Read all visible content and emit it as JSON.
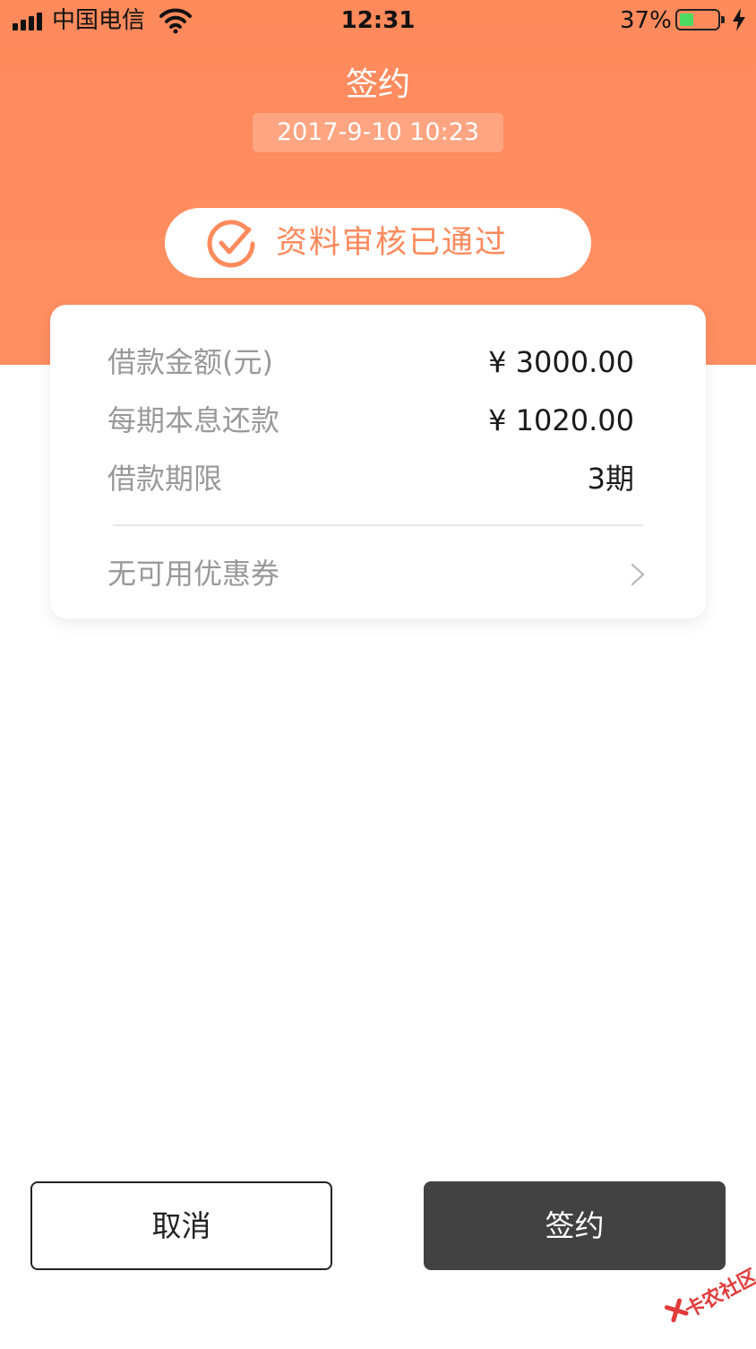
{
  "status_bar": {
    "carrier": "中国电信",
    "time": "12:31",
    "battery_percent": "37%",
    "battery_level": 0.37,
    "charging": true
  },
  "header": {
    "title": "签约",
    "datetime": "2017-9-10 10:23",
    "approval_text": "资料审核已通过",
    "accent_color": "#ff8a5c"
  },
  "loan_card": {
    "rows": [
      {
        "label": "借款金额(元)",
        "value": "¥ 3000.00"
      },
      {
        "label": "每期本息还款",
        "value": "¥ 1020.00"
      },
      {
        "label": "借款期限",
        "value": "3期"
      }
    ],
    "coupon_label": "无可用优惠券"
  },
  "actions": {
    "cancel_label": "取消",
    "sign_label": "签约"
  },
  "watermark": {
    "text": "卡农社区"
  }
}
